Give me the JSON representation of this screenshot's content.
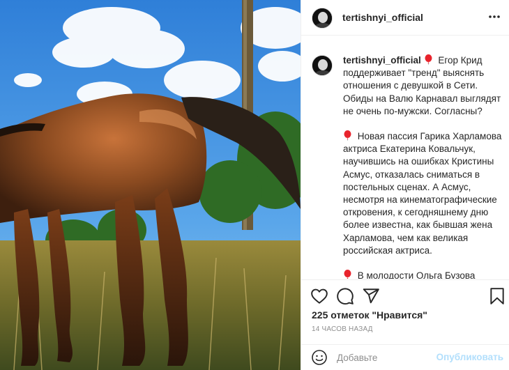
{
  "post": {
    "username": "tertishnyi_official",
    "more_icon": "more-horizontal-icon",
    "caption": {
      "username": "tertishnyi_official",
      "paragraphs": [
        "Егор Крид поддерживает \"тренд\" выяснять отношения с девушкой в Сети. Обиды на Валю Карнавал выглядят не очень по-мужски. Согласны?",
        "Новая пассия Гарика Харламова актриса Екатерина Ковальчук, научившись на ошибках Кристины Асмус, отказалась сниматься в постельных сценах. А Асмус, несмотря на кинематографические откровения, к сегодняшнему дню более известна, как бывшая жена Харламова, чем как великая российская актриса.",
        "В молодости Ольга Бузова рьяно подражала Бритни Спирс. Хорошо,"
      ]
    },
    "likes_text": "225 отметок \"Нравится\"",
    "time_text": "14 часов назад",
    "comment_placeholder": "Добавьте",
    "publish_label": "Опубликовать"
  },
  "colors": {
    "heart_emoji": "#e8232c",
    "publish_disabled": "#b2dffc",
    "muted": "#8e8e8e"
  },
  "icons": [
    "heart-icon",
    "comment-icon",
    "share-icon",
    "bookmark-icon",
    "smile-icon"
  ]
}
